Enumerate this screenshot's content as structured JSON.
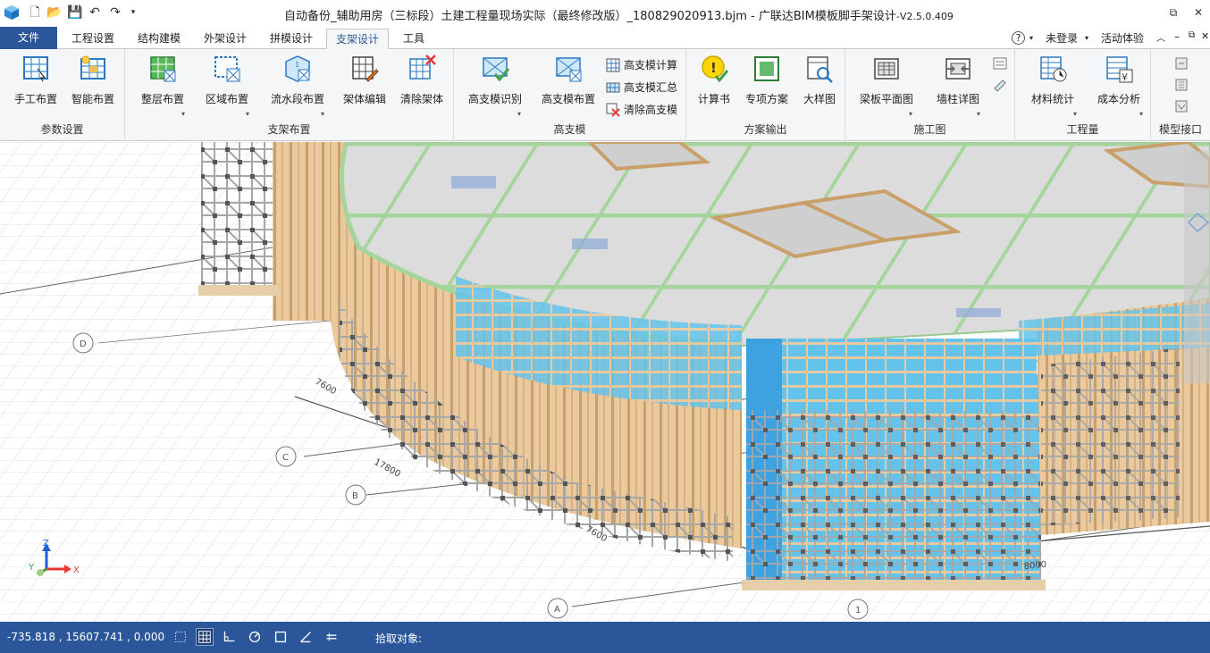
{
  "window": {
    "title": "自动备份_辅助用房（三标段）土建工程量现场实际（最终修改版）_180829020913.bjm - 广联达BIM模板脚手架设计",
    "version": "-V2.5.0.409",
    "restore_glyph": "⧉",
    "close_glyph": "✕"
  },
  "tabs": [
    {
      "label": "文件"
    },
    {
      "label": "工程设置"
    },
    {
      "label": "结构建模"
    },
    {
      "label": "外架设计"
    },
    {
      "label": "拼模设计"
    },
    {
      "label": "支架设计"
    },
    {
      "label": "工具"
    }
  ],
  "tab_right": {
    "help": "?",
    "login": "未登录",
    "activity": "活动体验"
  },
  "ribbon": {
    "groups": [
      {
        "label": "参数设置",
        "buttons": [
          "手工布置",
          "智能布置"
        ]
      },
      {
        "label": "支架布置",
        "buttons": [
          "整层布置",
          "区域布置",
          "流水段布置",
          "架体编辑",
          "清除架体"
        ]
      },
      {
        "label": "高支模",
        "buttons": [
          "高支模识别",
          "高支模布置"
        ],
        "small_buttons": [
          "高支模计算",
          "高支模汇总",
          "清除高支模"
        ]
      },
      {
        "label": "方案输出",
        "buttons": [
          "计算书",
          "专项方案",
          "大样图"
        ]
      },
      {
        "label": "施工图",
        "buttons": [
          "梁板平面图",
          "墙柱详图"
        ]
      },
      {
        "label": "工程量",
        "buttons": [
          "材料统计",
          "成本分析"
        ]
      },
      {
        "label": "模型接口",
        "buttons": []
      }
    ]
  },
  "viewport": {
    "axes": [
      "D",
      "C",
      "B",
      "A",
      "1"
    ],
    "dimensions": [
      "7600",
      "17800",
      "7600",
      "8000"
    ],
    "axis_labels": {
      "x": "X",
      "y": "Y",
      "z": "Z"
    }
  },
  "statusbar": {
    "coords": "-735.818 , 15607.741 , 0.000",
    "prompt": "拾取对象:"
  },
  "colors": {
    "accent": "#2b579a",
    "formwork": "#e8c9a0",
    "slab": "#d9d9d9",
    "beam": "#b8dcb0",
    "wall_blue": "#5bc0e8",
    "scaffold": "#b0b0b0"
  }
}
